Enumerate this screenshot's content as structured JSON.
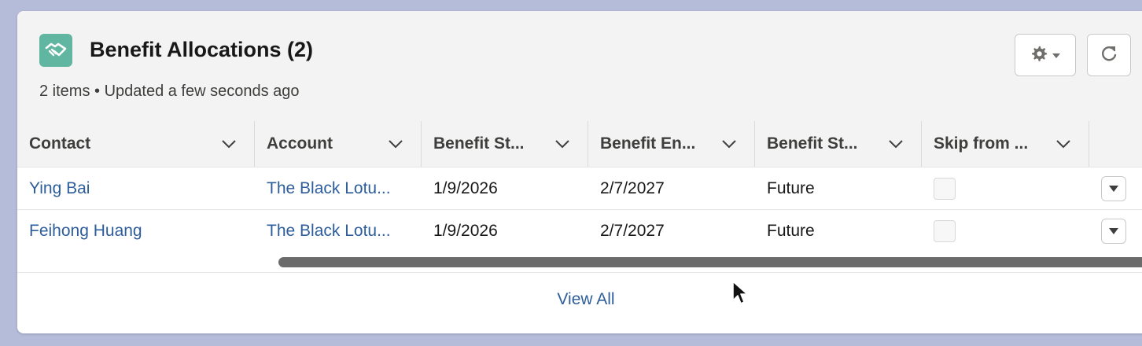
{
  "card": {
    "title": "Benefit Allocations (2)",
    "subtitle": "2 items • Updated a few seconds ago",
    "icon": "handshake-icon",
    "icon_color": "#60b6a0"
  },
  "actions": {
    "gear_icon": "gear-icon",
    "refresh_icon": "refresh-icon"
  },
  "table": {
    "columns": [
      {
        "label": "Contact"
      },
      {
        "label": "Account"
      },
      {
        "label": "Benefit St..."
      },
      {
        "label": "Benefit En..."
      },
      {
        "label": "Benefit St..."
      },
      {
        "label": "Skip from ..."
      }
    ],
    "rows": [
      {
        "contact": "Ying Bai",
        "account": "The Black Lotu...",
        "start": "1/9/2026",
        "end": "2/7/2027",
        "status": "Future",
        "skip": false
      },
      {
        "contact": "Feihong Huang",
        "account": "The Black Lotu...",
        "start": "1/9/2026",
        "end": "2/7/2027",
        "status": "Future",
        "skip": false
      }
    ]
  },
  "footer": {
    "view_all": "View All"
  },
  "colors": {
    "link": "#2e5d9c",
    "background": "#b4bcd9"
  }
}
